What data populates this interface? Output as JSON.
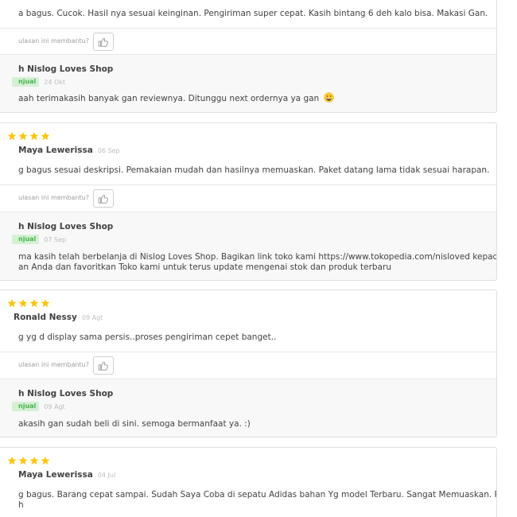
{
  "helpful_question": "ulasan ini membantu?",
  "seller_badge": "njual",
  "reviews": [
    {
      "reviewer": "",
      "date": "",
      "text": "a bagus. Cucok. Hasil nya sesuai keinginan. Pengiriman super cepat. Kasih bintang 6 deh kalo bisa. Makasi Gan.",
      "reply": {
        "seller": "h Nislog Loves Shop",
        "date": "24 Okt",
        "lines": [
          "aah terimakasih banyak gan reviewnya. Ditunggu next ordernya ya gan"
        ]
      }
    },
    {
      "reviewer": "Maya Lewerissa",
      "date": "06 Sep",
      "text": "g bagus sesuai deskripsi. Pemakaian mudah dan hasilnya memuaskan. Paket datang lama tidak sesuai harapan.",
      "reply": {
        "seller": "h Nislog Loves Shop",
        "date": "07 Sep",
        "lines": [
          "ma kasih telah berbelanja di Nislog Loves Shop. Bagikan link toko kami https://www.tokopedia.com/nisloved kepada teman-",
          "an Anda dan favoritkan Toko kami untuk terus update mengenai stok dan produk terbaru"
        ]
      }
    },
    {
      "reviewer": "Ronald Nessy",
      "date": "09 Agt",
      "text": "g yg d display sama persis..proses pengiriman cepet banget..",
      "reply": {
        "seller": "h Nislog Loves Shop",
        "date": "09 Agt",
        "lines": [
          "akasih gan sudah beli di sini. semoga bermanfaat ya. :)"
        ]
      }
    },
    {
      "reviewer": "Maya Lewerissa",
      "date": "04 Jul",
      "lines": [
        "g bagus. Barang cepat sampai.  Sudah Saya Coba di sepatu Adidas bahan Yg model Terbaru. Sangat Memuaskan. Pemakaian",
        "h"
      ]
    }
  ],
  "colors": {
    "star": "#ffc400",
    "badge_text": "#42b549",
    "badge_bg": "#d5f0d5",
    "reply_bg": "#f8f8f8"
  },
  "icons": {
    "star": "star-icon",
    "like": "thumbs-up-icon",
    "emoji": "grinning-face-icon"
  }
}
